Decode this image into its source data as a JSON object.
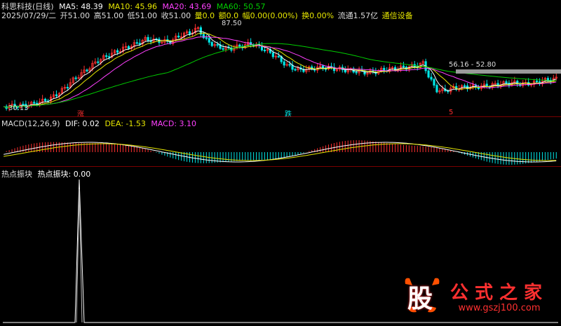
{
  "price_panel": {
    "stock_name": "科思科技(日线)",
    "ma5_label": "MA5: 48.39",
    "ma10_label": "MA10: 45.96",
    "ma20_label": "MA20: 43.69",
    "ma60_label": "MA60: 50.57",
    "date": "2025/07/29/二",
    "open": "开51.00",
    "high": "高51.00",
    "low": "低51.00",
    "close": "收51.00",
    "vol": "量0.0",
    "amount": "额0.0",
    "change": "幅0.00(0.00%)",
    "turnover": "换0.00%",
    "float_cap": "流通1.57亿",
    "sector": "通信设备",
    "high_mark": "87.50",
    "low_mark": "30.13",
    "range_label": "56.16 - 52.80",
    "badge_zhang": "涨",
    "badge_die": "跌",
    "badge_shi": "5",
    "colors": {
      "ma5": "#ffffff",
      "ma10": "#e6e600",
      "ma20": "#ff40ff",
      "ma60": "#00cc00",
      "up": "#ff3030",
      "down": "#00e5e5"
    }
  },
  "macd_panel": {
    "title": "MACD(12,26,9)",
    "dif": "DIF: 0.02",
    "dea": "DEA: -1.53",
    "macd": "MACD: 3.10"
  },
  "hot_panel": {
    "title": "热点振块",
    "label": "热点振块: 0.00"
  },
  "watermark": {
    "logo": "股",
    "title": "公式之家",
    "url": "www.gszj100.com"
  }
}
